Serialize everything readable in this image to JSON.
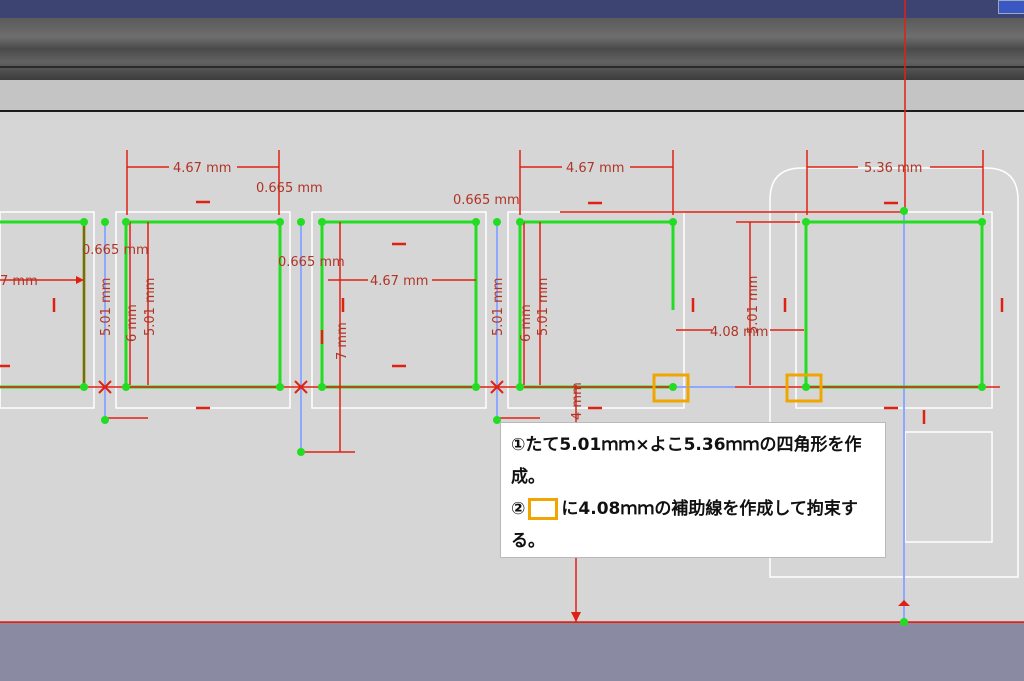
{
  "app": {
    "accent": "#f0a500",
    "sketch_line_color": "#22dd22",
    "dimension_color": "#e02010",
    "construction_color": "#8fa8ff"
  },
  "dimensions": {
    "d1": "4.67 mm",
    "d2": "0.665 mm",
    "d3": "0.665 mm",
    "d4": "4.67 mm",
    "d5": "4.67 mm",
    "d6": "5.36 mm",
    "d7": "7 mm",
    "d8": "0.665 mm",
    "d9": "0.665 mm",
    "d10": "5.01 mm",
    "d11": "6 mm",
    "d12": "5.01 mm",
    "d13": "7 mm",
    "d14": "5.01 mm",
    "d15": "6 mm",
    "d16": "5.01 mm",
    "d17": "4.08 mm",
    "d18": "5.01 mm",
    "d19": "4 mm"
  },
  "note": {
    "line1": "①たて5.01ｍｍ×よこ5.36ｍｍの四角形を作成。",
    "line2_prefix": "②",
    "line2_suffix": "に4.08ｍｍの補助線を作成して拘束する。"
  }
}
